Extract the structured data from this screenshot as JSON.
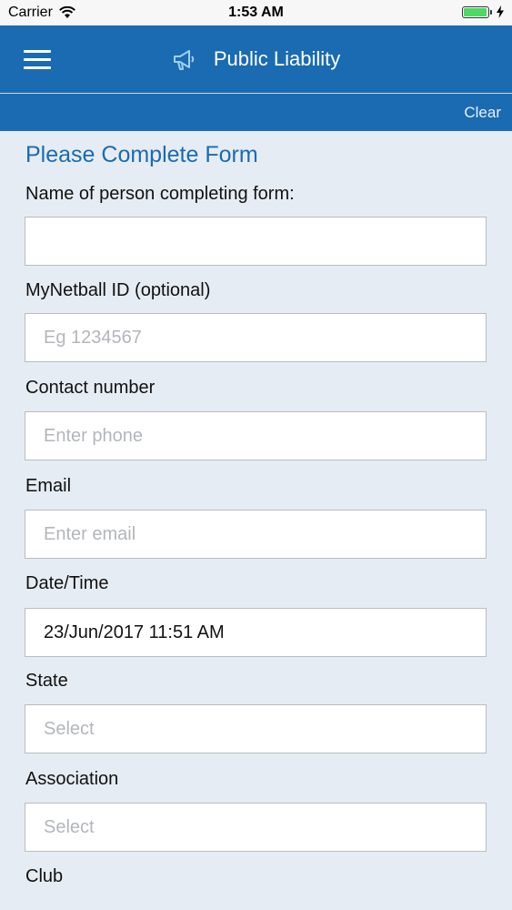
{
  "status": {
    "carrier": "Carrier",
    "time": "1:53 AM",
    "battery_level": 0.95
  },
  "nav": {
    "title": "Public Liability",
    "clear_label": "Clear"
  },
  "form": {
    "title": "Please Complete Form",
    "fields": [
      {
        "label": "Name of person completing form:",
        "value": "",
        "placeholder": ""
      },
      {
        "label": "MyNetball ID (optional)",
        "value": "",
        "placeholder": "Eg 1234567"
      },
      {
        "label": "Contact number",
        "value": "",
        "placeholder": "Enter phone"
      },
      {
        "label": "Email",
        "value": "",
        "placeholder": "Enter email"
      },
      {
        "label": "Date/Time",
        "value": "23/Jun/2017 11:51 AM",
        "placeholder": ""
      },
      {
        "label": "State",
        "value": "Select"
      },
      {
        "label": "Association",
        "value": "Select"
      },
      {
        "label": "Club"
      }
    ]
  },
  "colors": {
    "nav_blue": "#1a6bb1",
    "title_blue": "#1a6bb1",
    "background": "#e6ecf3",
    "battery_green": "#4cd964"
  }
}
